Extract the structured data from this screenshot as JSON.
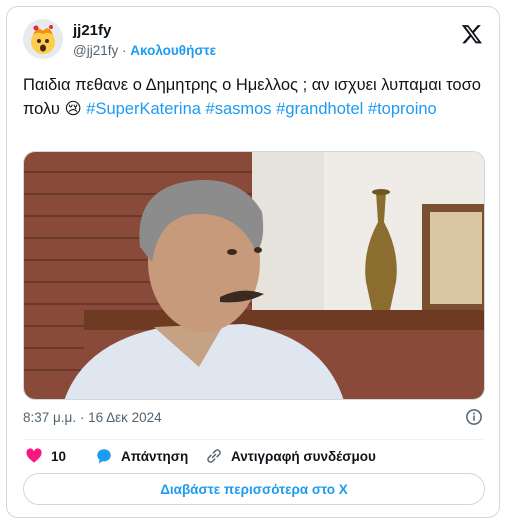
{
  "user": {
    "name": "jj21fy",
    "handle": "@jj21fy",
    "separator": "·",
    "follow_label": "Ακολουθήστε"
  },
  "tweet": {
    "text_parts": [
      {
        "text": "Παιδια πεθανε ο Δημητρης ο Ημελλος ; αν ισχυει λυπαμαι τοσο πολυ 😢 ",
        "type": "text"
      },
      {
        "text": "#SuperKaterina",
        "type": "tag"
      },
      {
        "text": " ",
        "type": "text"
      },
      {
        "text": "#sasmos",
        "type": "tag"
      },
      {
        "text": " ",
        "type": "text"
      },
      {
        "text": "#grandhotel",
        "type": "tag"
      },
      {
        "text": " ",
        "type": "text"
      },
      {
        "text": "#toproino",
        "type": "tag"
      }
    ],
    "timestamp": "8:37 μ.μ. · 16 Δεκ 2024"
  },
  "actions": {
    "like_count": "10",
    "reply_label": "Απάντηση",
    "copy_link_label": "Αντιγραφή συνδέσμου"
  },
  "read_more_label": "Διαβάστε περισσότερα στο X",
  "colors": {
    "accent": "#1d9bf0",
    "like": "#f91880",
    "text": "#0f1419",
    "muted": "#536471",
    "border": "#cfd9de"
  }
}
